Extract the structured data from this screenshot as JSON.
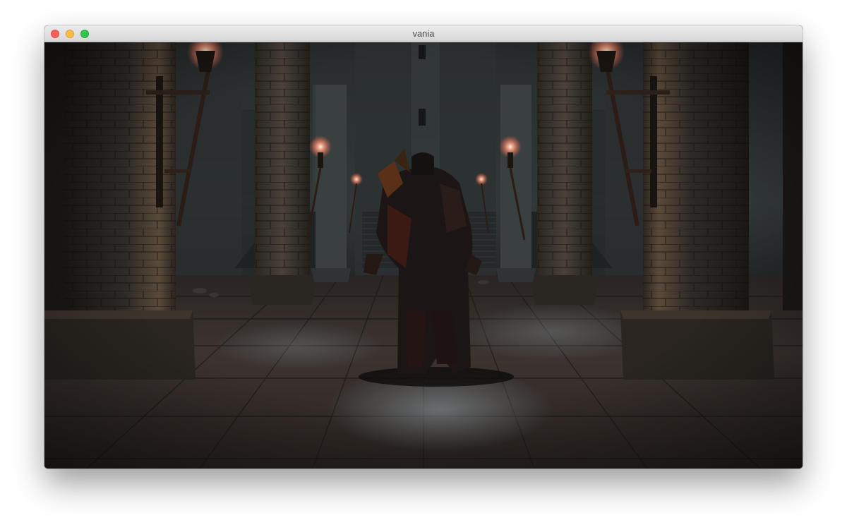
{
  "window": {
    "title": "vania",
    "buttons": {
      "close": "close-button",
      "minimize": "minimize-button",
      "maximize": "maximize-button"
    }
  },
  "scene": {
    "description_icon": "game-viewport",
    "colors": {
      "stone_dark": "#1f1c19",
      "stone_mid": "#3a342d",
      "stone_light": "#5a5046",
      "hall_back": "#2a2f30",
      "floor_tile": "#4a3f36",
      "fire": "#ffb0a0",
      "character": "#1a1414"
    }
  }
}
